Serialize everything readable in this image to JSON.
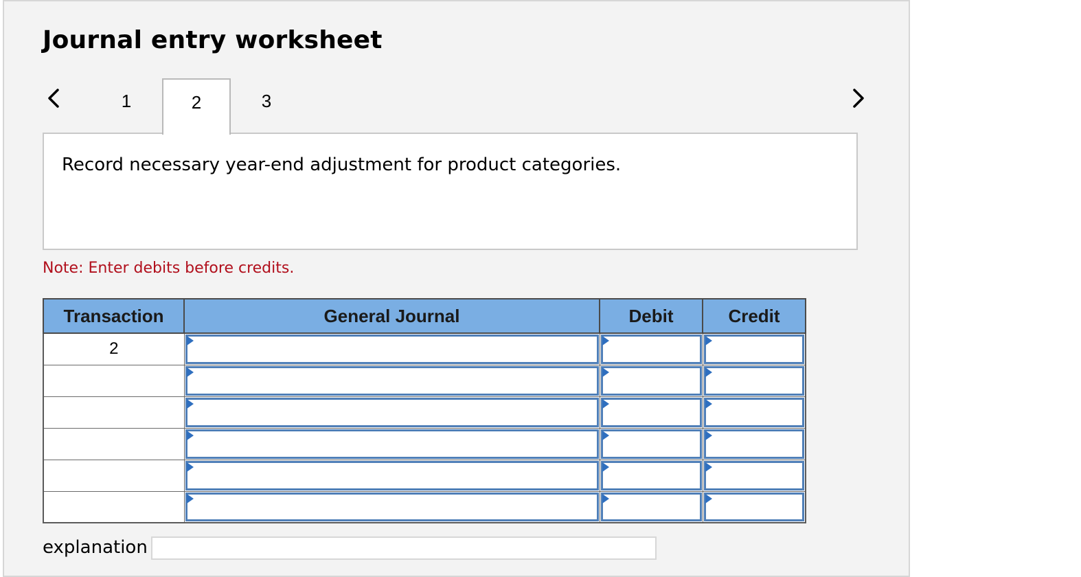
{
  "title": "Journal entry worksheet",
  "nav": {
    "prev_icon": "chevron-left-icon",
    "next_icon": "chevron-right-icon"
  },
  "tabs": [
    {
      "label": "1"
    },
    {
      "label": "2",
      "active": true
    },
    {
      "label": "3"
    }
  ],
  "instruction": "Record necessary year-end adjustment for product categories.",
  "note": "Note: Enter debits before credits.",
  "table": {
    "headers": {
      "transaction": "Transaction",
      "general_journal": "General Journal",
      "debit": "Debit",
      "credit": "Credit"
    },
    "rows": [
      {
        "transaction": "2",
        "account": "",
        "debit": "",
        "credit": ""
      },
      {
        "transaction": "",
        "account": "",
        "debit": "",
        "credit": ""
      },
      {
        "transaction": "",
        "account": "",
        "debit": "",
        "credit": ""
      },
      {
        "transaction": "",
        "account": "",
        "debit": "",
        "credit": ""
      },
      {
        "transaction": "",
        "account": "",
        "debit": "",
        "credit": ""
      },
      {
        "transaction": "",
        "account": "",
        "debit": "",
        "credit": ""
      }
    ]
  },
  "explanation": {
    "label": "explanation",
    "value": ""
  },
  "colors": {
    "header_bg": "#7aaee3",
    "note_red": "#b10f1c",
    "entry_border": "#4f7fb8"
  }
}
